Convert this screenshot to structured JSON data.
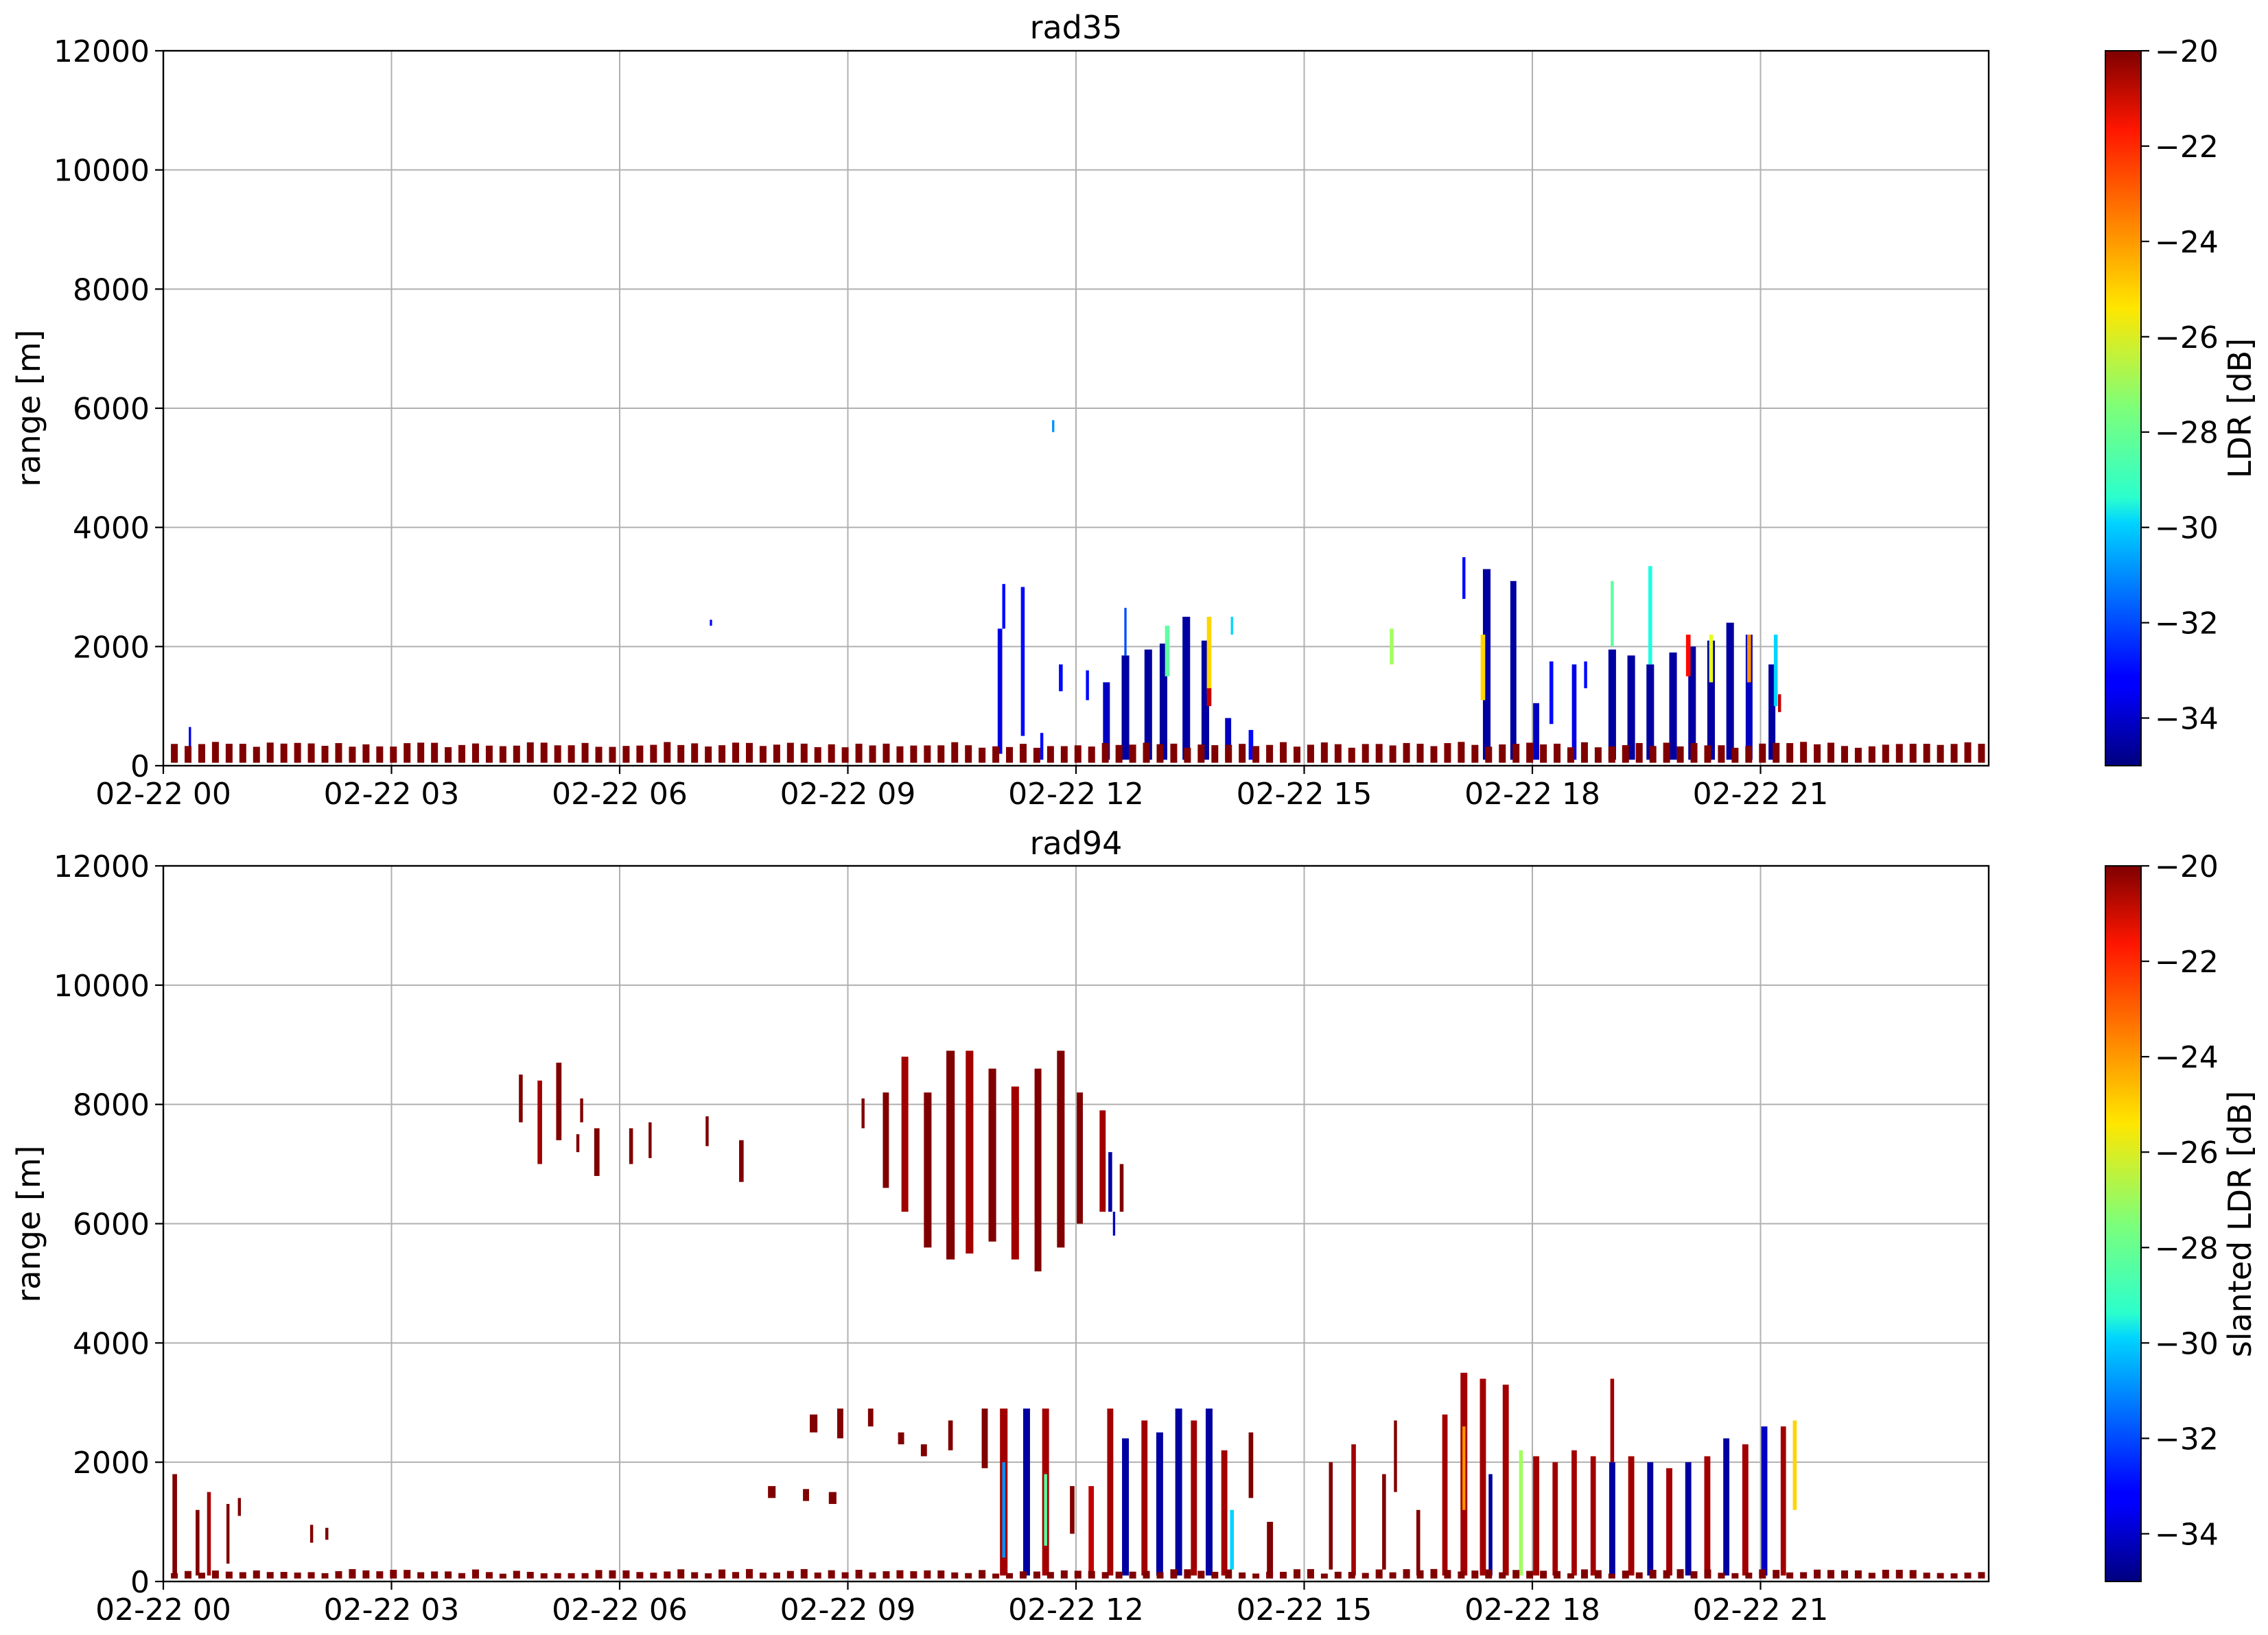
{
  "chart_data": [
    {
      "type": "heatmap",
      "title": "rad35",
      "ylabel": "range [m]",
      "xlabel": "",
      "ylim": [
        0,
        12000
      ],
      "xlim_hours": [
        0,
        24
      ],
      "yticks": [
        0,
        2000,
        4000,
        6000,
        8000,
        10000,
        12000
      ],
      "xtick_hours": [
        0,
        3,
        6,
        9,
        12,
        15,
        18,
        21
      ],
      "xtick_labels": [
        "02-22 00",
        "02-22 03",
        "02-22 06",
        "02-22 09",
        "02-22 12",
        "02-22 15",
        "02-22 18",
        "02-22 21"
      ],
      "grid": true,
      "colorbar": {
        "label": "LDR [dB]",
        "range": [
          -35,
          -20
        ],
        "ticks": [
          -34,
          -32,
          -30,
          -28,
          -26,
          -24,
          -22,
          -20
        ],
        "tick_labels": [
          "−34",
          "−32",
          "−30",
          "−28",
          "−26",
          "−24",
          "−22",
          "−20"
        ],
        "colormap": "jet"
      },
      "echoes": [
        {
          "h": 0.35,
          "y0": 50,
          "y1": 650,
          "ldr": -33.5,
          "w": 0.03
        },
        {
          "h": 7.2,
          "y0": 2350,
          "y1": 2450,
          "ldr": -33,
          "w": 0.03
        },
        {
          "h": 11.0,
          "y0": 200,
          "y1": 2300,
          "ldr": -33.5,
          "w": 0.06
        },
        {
          "h": 11.05,
          "y0": 2300,
          "y1": 3050,
          "ldr": -33,
          "w": 0.04
        },
        {
          "h": 11.3,
          "y0": 500,
          "y1": 3000,
          "ldr": -33,
          "w": 0.05
        },
        {
          "h": 11.55,
          "y0": 100,
          "y1": 550,
          "ldr": -33,
          "w": 0.04
        },
        {
          "h": 11.8,
          "y0": 1250,
          "y1": 1700,
          "ldr": -33,
          "w": 0.05
        },
        {
          "h": 12.15,
          "y0": 1100,
          "y1": 1600,
          "ldr": -33,
          "w": 0.04
        },
        {
          "h": 11.7,
          "y0": 5600,
          "y1": 5800,
          "ldr": -31,
          "w": 0.03
        },
        {
          "h": 12.4,
          "y0": 100,
          "y1": 1400,
          "ldr": -34,
          "w": 0.09
        },
        {
          "h": 12.65,
          "y0": 100,
          "y1": 1850,
          "ldr": -34.5,
          "w": 0.1
        },
        {
          "h": 12.65,
          "y0": 1850,
          "y1": 2650,
          "ldr": -32,
          "w": 0.03
        },
        {
          "h": 12.95,
          "y0": 100,
          "y1": 1950,
          "ldr": -34.5,
          "w": 0.1
        },
        {
          "h": 13.15,
          "y0": 100,
          "y1": 2050,
          "ldr": -34.5,
          "w": 0.1
        },
        {
          "h": 13.2,
          "y0": 1500,
          "y1": 2350,
          "ldr": -28,
          "w": 0.06
        },
        {
          "h": 13.45,
          "y0": 100,
          "y1": 2500,
          "ldr": -34.5,
          "w": 0.1
        },
        {
          "h": 13.7,
          "y0": 100,
          "y1": 2100,
          "ldr": -34.5,
          "w": 0.1
        },
        {
          "h": 13.75,
          "y0": 1200,
          "y1": 2500,
          "ldr": -25,
          "w": 0.06
        },
        {
          "h": 13.75,
          "y0": 1000,
          "y1": 1300,
          "ldr": -21,
          "w": 0.06
        },
        {
          "h": 14.0,
          "y0": 100,
          "y1": 800,
          "ldr": -34,
          "w": 0.08
        },
        {
          "h": 14.05,
          "y0": 2200,
          "y1": 2500,
          "ldr": -30,
          "w": 0.03
        },
        {
          "h": 14.3,
          "y0": 100,
          "y1": 600,
          "ldr": -33,
          "w": 0.06
        },
        {
          "h": 15.8,
          "y0": 100,
          "y1": 350,
          "ldr": -33,
          "w": 0.05
        },
        {
          "h": 16.15,
          "y0": 1700,
          "y1": 2300,
          "ldr": -27,
          "w": 0.05
        },
        {
          "h": 17.1,
          "y0": 2800,
          "y1": 3500,
          "ldr": -33,
          "w": 0.04
        },
        {
          "h": 17.4,
          "y0": 100,
          "y1": 3300,
          "ldr": -34.5,
          "w": 0.1
        },
        {
          "h": 17.35,
          "y0": 1100,
          "y1": 2200,
          "ldr": -25,
          "w": 0.06
        },
        {
          "h": 17.75,
          "y0": 100,
          "y1": 3100,
          "ldr": -34.5,
          "w": 0.08
        },
        {
          "h": 18.05,
          "y0": 100,
          "y1": 1050,
          "ldr": -34,
          "w": 0.08
        },
        {
          "h": 18.25,
          "y0": 700,
          "y1": 1750,
          "ldr": -33,
          "w": 0.05
        },
        {
          "h": 18.55,
          "y0": 100,
          "y1": 1700,
          "ldr": -33.5,
          "w": 0.06
        },
        {
          "h": 18.7,
          "y0": 1300,
          "y1": 1750,
          "ldr": -33,
          "w": 0.04
        },
        {
          "h": 19.05,
          "y0": 100,
          "y1": 1950,
          "ldr": -34.5,
          "w": 0.1
        },
        {
          "h": 19.05,
          "y0": 2000,
          "y1": 3100,
          "ldr": -28,
          "w": 0.04
        },
        {
          "h": 19.3,
          "y0": 100,
          "y1": 1850,
          "ldr": -34.5,
          "w": 0.1
        },
        {
          "h": 19.55,
          "y0": 100,
          "y1": 1700,
          "ldr": -34.5,
          "w": 0.1
        },
        {
          "h": 19.55,
          "y0": 1700,
          "y1": 3350,
          "ldr": -29,
          "w": 0.05
        },
        {
          "h": 19.85,
          "y0": 100,
          "y1": 1900,
          "ldr": -34.5,
          "w": 0.1
        },
        {
          "h": 20.1,
          "y0": 100,
          "y1": 2000,
          "ldr": -34.5,
          "w": 0.1
        },
        {
          "h": 20.05,
          "y0": 1500,
          "y1": 2200,
          "ldr": -22,
          "w": 0.06
        },
        {
          "h": 20.35,
          "y0": 100,
          "y1": 2100,
          "ldr": -34.5,
          "w": 0.1
        },
        {
          "h": 20.35,
          "y0": 1400,
          "y1": 2200,
          "ldr": -26,
          "w": 0.05
        },
        {
          "h": 20.6,
          "y0": 100,
          "y1": 2400,
          "ldr": -34.5,
          "w": 0.1
        },
        {
          "h": 20.85,
          "y0": 100,
          "y1": 2200,
          "ldr": -34,
          "w": 0.09
        },
        {
          "h": 20.85,
          "y0": 1400,
          "y1": 2200,
          "ldr": -24,
          "w": 0.05
        },
        {
          "h": 21.15,
          "y0": 100,
          "y1": 1700,
          "ldr": -34.5,
          "w": 0.09
        },
        {
          "h": 21.2,
          "y0": 1000,
          "y1": 2200,
          "ldr": -30,
          "w": 0.05
        },
        {
          "h": 21.25,
          "y0": 900,
          "y1": 1200,
          "ldr": -21,
          "w": 0.04
        }
      ]
    },
    {
      "type": "heatmap",
      "title": "rad94",
      "ylabel": "range [m]",
      "xlabel": "",
      "ylim": [
        0,
        12000
      ],
      "xlim_hours": [
        0,
        24
      ],
      "yticks": [
        0,
        2000,
        4000,
        6000,
        8000,
        10000,
        12000
      ],
      "xtick_hours": [
        0,
        3,
        6,
        9,
        12,
        15,
        18,
        21
      ],
      "xtick_labels": [
        "02-22 00",
        "02-22 03",
        "02-22 06",
        "02-22 09",
        "02-22 12",
        "02-22 15",
        "02-22 18",
        "02-22 21"
      ],
      "grid": true,
      "colorbar": {
        "label": "slanted LDR [dB]",
        "range": [
          -35,
          -20
        ],
        "ticks": [
          -34,
          -32,
          -30,
          -28,
          -26,
          -24,
          -22,
          -20
        ],
        "tick_labels": [
          "−34",
          "−32",
          "−30",
          "−28",
          "−26",
          "−24",
          "−22",
          "−20"
        ],
        "colormap": "jet"
      },
      "echoes": [
        {
          "h": 0.15,
          "y0": 100,
          "y1": 1800,
          "ldr": -20,
          "w": 0.06
        },
        {
          "h": 0.45,
          "y0": 100,
          "y1": 1200,
          "ldr": -20,
          "w": 0.05
        },
        {
          "h": 0.6,
          "y0": 100,
          "y1": 1500,
          "ldr": -20.5,
          "w": 0.05
        },
        {
          "h": 0.85,
          "y0": 300,
          "y1": 1300,
          "ldr": -20,
          "w": 0.04
        },
        {
          "h": 1.0,
          "y0": 1100,
          "y1": 1400,
          "ldr": -20,
          "w": 0.04
        },
        {
          "h": 1.95,
          "y0": 650,
          "y1": 950,
          "ldr": -20,
          "w": 0.04
        },
        {
          "h": 2.15,
          "y0": 700,
          "y1": 900,
          "ldr": -20,
          "w": 0.04
        },
        {
          "h": 4.7,
          "y0": 7700,
          "y1": 8500,
          "ldr": -20,
          "w": 0.05
        },
        {
          "h": 4.95,
          "y0": 7000,
          "y1": 8400,
          "ldr": -20.5,
          "w": 0.06
        },
        {
          "h": 5.2,
          "y0": 7400,
          "y1": 8700,
          "ldr": -20,
          "w": 0.07
        },
        {
          "h": 5.5,
          "y0": 7700,
          "y1": 8100,
          "ldr": -20,
          "w": 0.04
        },
        {
          "h": 5.45,
          "y0": 7200,
          "y1": 7500,
          "ldr": -20,
          "w": 0.04
        },
        {
          "h": 5.7,
          "y0": 6800,
          "y1": 7600,
          "ldr": -20,
          "w": 0.07
        },
        {
          "h": 6.15,
          "y0": 7000,
          "y1": 7600,
          "ldr": -20,
          "w": 0.05
        },
        {
          "h": 6.4,
          "y0": 7100,
          "y1": 7700,
          "ldr": -20,
          "w": 0.04
        },
        {
          "h": 7.15,
          "y0": 7300,
          "y1": 7800,
          "ldr": -20,
          "w": 0.04
        },
        {
          "h": 7.6,
          "y0": 6700,
          "y1": 7400,
          "ldr": -20,
          "w": 0.06
        },
        {
          "h": 9.2,
          "y0": 7600,
          "y1": 8100,
          "ldr": -20,
          "w": 0.04
        },
        {
          "h": 9.5,
          "y0": 6600,
          "y1": 8200,
          "ldr": -20,
          "w": 0.08
        },
        {
          "h": 9.75,
          "y0": 6200,
          "y1": 8800,
          "ldr": -20.5,
          "w": 0.09
        },
        {
          "h": 10.05,
          "y0": 5600,
          "y1": 8200,
          "ldr": -20,
          "w": 0.1
        },
        {
          "h": 10.35,
          "y0": 5400,
          "y1": 8900,
          "ldr": -20,
          "w": 0.11
        },
        {
          "h": 10.6,
          "y0": 5500,
          "y1": 8900,
          "ldr": -20.5,
          "w": 0.1
        },
        {
          "h": 10.9,
          "y0": 5700,
          "y1": 8600,
          "ldr": -20,
          "w": 0.1
        },
        {
          "h": 11.2,
          "y0": 5400,
          "y1": 8300,
          "ldr": -20.5,
          "w": 0.1
        },
        {
          "h": 11.5,
          "y0": 5200,
          "y1": 8600,
          "ldr": -20,
          "w": 0.09
        },
        {
          "h": 11.8,
          "y0": 5600,
          "y1": 8900,
          "ldr": -20,
          "w": 0.1
        },
        {
          "h": 12.05,
          "y0": 6000,
          "y1": 8200,
          "ldr": -20,
          "w": 0.08
        },
        {
          "h": 12.35,
          "y0": 6200,
          "y1": 7900,
          "ldr": -20.5,
          "w": 0.08
        },
        {
          "h": 12.6,
          "y0": 6200,
          "y1": 7000,
          "ldr": -20,
          "w": 0.05
        },
        {
          "h": 12.45,
          "y0": 6200,
          "y1": 7200,
          "ldr": -34.5,
          "w": 0.05
        },
        {
          "h": 12.5,
          "y0": 5800,
          "y1": 6200,
          "ldr": -34,
          "w": 0.03
        },
        {
          "h": 8.0,
          "y0": 1400,
          "y1": 1600,
          "ldr": -20,
          "w": 0.1
        },
        {
          "h": 8.45,
          "y0": 1350,
          "y1": 1550,
          "ldr": -20,
          "w": 0.08
        },
        {
          "h": 8.8,
          "y0": 1300,
          "y1": 1500,
          "ldr": -20,
          "w": 0.1
        },
        {
          "h": 8.55,
          "y0": 2500,
          "y1": 2800,
          "ldr": -20,
          "w": 0.1
        },
        {
          "h": 8.9,
          "y0": 2400,
          "y1": 2900,
          "ldr": -20,
          "w": 0.08
        },
        {
          "h": 9.3,
          "y0": 2600,
          "y1": 2900,
          "ldr": -20,
          "w": 0.07
        },
        {
          "h": 9.7,
          "y0": 2300,
          "y1": 2500,
          "ldr": -20,
          "w": 0.08
        },
        {
          "h": 10.0,
          "y0": 2100,
          "y1": 2300,
          "ldr": -20,
          "w": 0.08
        },
        {
          "h": 10.35,
          "y0": 2200,
          "y1": 2700,
          "ldr": -20,
          "w": 0.06
        },
        {
          "h": 10.8,
          "y0": 1900,
          "y1": 2900,
          "ldr": -20,
          "w": 0.08
        },
        {
          "h": 11.05,
          "y0": 100,
          "y1": 2900,
          "ldr": -20.5,
          "w": 0.1
        },
        {
          "h": 11.05,
          "y0": 400,
          "y1": 2000,
          "ldr": -31,
          "w": 0.04
        },
        {
          "h": 11.35,
          "y0": 100,
          "y1": 2900,
          "ldr": -34.5,
          "w": 0.09
        },
        {
          "h": 11.6,
          "y0": 100,
          "y1": 2900,
          "ldr": -20.5,
          "w": 0.09
        },
        {
          "h": 11.6,
          "y0": 600,
          "y1": 1800,
          "ldr": -28,
          "w": 0.04
        },
        {
          "h": 11.95,
          "y0": 800,
          "y1": 1600,
          "ldr": -20,
          "w": 0.06
        },
        {
          "h": 12.2,
          "y0": 100,
          "y1": 1600,
          "ldr": -21,
          "w": 0.07
        },
        {
          "h": 12.45,
          "y0": 100,
          "y1": 2900,
          "ldr": -20.5,
          "w": 0.08
        },
        {
          "h": 12.65,
          "y0": 100,
          "y1": 2400,
          "ldr": -34.5,
          "w": 0.09
        },
        {
          "h": 12.9,
          "y0": 100,
          "y1": 2700,
          "ldr": -20.5,
          "w": 0.08
        },
        {
          "h": 13.1,
          "y0": 100,
          "y1": 2500,
          "ldr": -34.5,
          "w": 0.09
        },
        {
          "h": 13.35,
          "y0": 100,
          "y1": 2900,
          "ldr": -34.5,
          "w": 0.09
        },
        {
          "h": 13.55,
          "y0": 100,
          "y1": 2700,
          "ldr": -20.5,
          "w": 0.08
        },
        {
          "h": 13.75,
          "y0": 100,
          "y1": 2900,
          "ldr": -34.5,
          "w": 0.09
        },
        {
          "h": 13.95,
          "y0": 100,
          "y1": 2200,
          "ldr": -20.5,
          "w": 0.08
        },
        {
          "h": 14.05,
          "y0": 200,
          "y1": 1200,
          "ldr": -30,
          "w": 0.05
        },
        {
          "h": 14.3,
          "y0": 1400,
          "y1": 2500,
          "ldr": -20,
          "w": 0.06
        },
        {
          "h": 14.55,
          "y0": 100,
          "y1": 1000,
          "ldr": -20,
          "w": 0.08
        },
        {
          "h": 15.35,
          "y0": 200,
          "y1": 2000,
          "ldr": -20,
          "w": 0.05
        },
        {
          "h": 15.65,
          "y0": 100,
          "y1": 2300,
          "ldr": -20.5,
          "w": 0.06
        },
        {
          "h": 16.05,
          "y0": 200,
          "y1": 1800,
          "ldr": -20,
          "w": 0.05
        },
        {
          "h": 16.2,
          "y0": 1500,
          "y1": 2700,
          "ldr": -20,
          "w": 0.04
        },
        {
          "h": 16.5,
          "y0": 100,
          "y1": 1200,
          "ldr": -20,
          "w": 0.05
        },
        {
          "h": 16.85,
          "y0": 100,
          "y1": 2800,
          "ldr": -20.5,
          "w": 0.07
        },
        {
          "h": 17.1,
          "y0": 100,
          "y1": 3500,
          "ldr": -20.5,
          "w": 0.09
        },
        {
          "h": 17.1,
          "y0": 1200,
          "y1": 2600,
          "ldr": -24,
          "w": 0.04
        },
        {
          "h": 17.35,
          "y0": 100,
          "y1": 3400,
          "ldr": -20.5,
          "w": 0.08
        },
        {
          "h": 17.45,
          "y0": 100,
          "y1": 1800,
          "ldr": -34.5,
          "w": 0.05
        },
        {
          "h": 17.65,
          "y0": 100,
          "y1": 3300,
          "ldr": -20.5,
          "w": 0.08
        },
        {
          "h": 17.85,
          "y0": 100,
          "y1": 2200,
          "ldr": -27,
          "w": 0.05
        },
        {
          "h": 18.05,
          "y0": 100,
          "y1": 2100,
          "ldr": -20.5,
          "w": 0.08
        },
        {
          "h": 18.3,
          "y0": 100,
          "y1": 2000,
          "ldr": -20.5,
          "w": 0.07
        },
        {
          "h": 18.55,
          "y0": 100,
          "y1": 2200,
          "ldr": -20.5,
          "w": 0.07
        },
        {
          "h": 18.8,
          "y0": 100,
          "y1": 2100,
          "ldr": -20.5,
          "w": 0.07
        },
        {
          "h": 19.05,
          "y0": 100,
          "y1": 2000,
          "ldr": -34.5,
          "w": 0.08
        },
        {
          "h": 19.05,
          "y0": 2000,
          "y1": 3400,
          "ldr": -20.5,
          "w": 0.05
        },
        {
          "h": 19.3,
          "y0": 100,
          "y1": 2100,
          "ldr": -20.5,
          "w": 0.08
        },
        {
          "h": 19.55,
          "y0": 100,
          "y1": 2000,
          "ldr": -34.5,
          "w": 0.08
        },
        {
          "h": 19.8,
          "y0": 100,
          "y1": 1900,
          "ldr": -20.5,
          "w": 0.08
        },
        {
          "h": 20.05,
          "y0": 100,
          "y1": 2000,
          "ldr": -34.5,
          "w": 0.08
        },
        {
          "h": 20.3,
          "y0": 100,
          "y1": 2100,
          "ldr": -20.5,
          "w": 0.08
        },
        {
          "h": 20.55,
          "y0": 100,
          "y1": 2400,
          "ldr": -34.5,
          "w": 0.08
        },
        {
          "h": 20.8,
          "y0": 100,
          "y1": 2300,
          "ldr": -20.5,
          "w": 0.08
        },
        {
          "h": 21.05,
          "y0": 100,
          "y1": 2600,
          "ldr": -34,
          "w": 0.08
        },
        {
          "h": 21.3,
          "y0": 100,
          "y1": 2600,
          "ldr": -20.5,
          "w": 0.07
        },
        {
          "h": 21.45,
          "y0": 1200,
          "y1": 2700,
          "ldr": -25,
          "w": 0.05
        }
      ]
    }
  ]
}
